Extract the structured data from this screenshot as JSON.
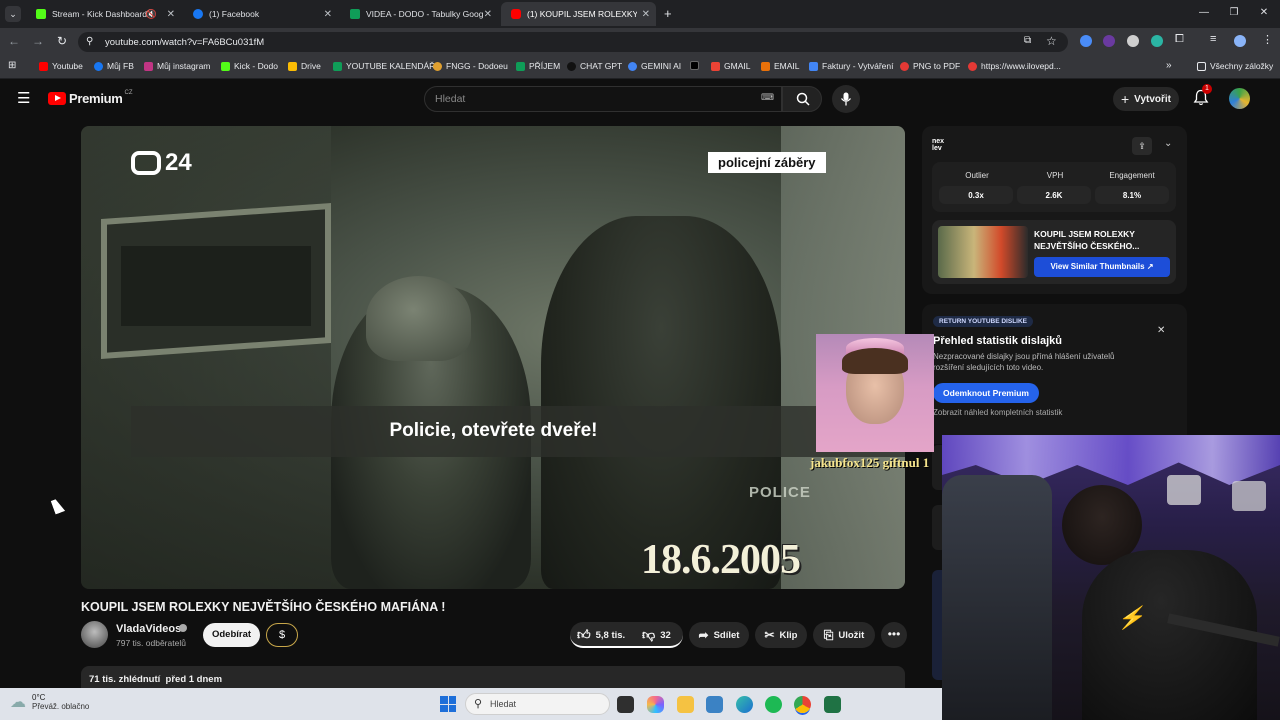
{
  "tabs": [
    {
      "title": "Stream - Kick Dashboard",
      "color": "#53fc18"
    },
    {
      "title": "(1) Facebook",
      "color": "#1877f2"
    },
    {
      "title": "VIDEA - DODO - Tabulky Goog",
      "color": "#0f9d58"
    },
    {
      "title": "(1) KOUPIL JSEM ROLEXKY NEJ",
      "color": "#ff0000"
    }
  ],
  "address": {
    "url": "youtube.com/watch?v=FA6BCu031fM"
  },
  "bookmarks": [
    {
      "label": "Youtube",
      "color": "#ff0000"
    },
    {
      "label": "Můj FB",
      "color": "#1877f2"
    },
    {
      "label": "Můj instagram",
      "color": "#c13584"
    },
    {
      "label": "Kick - Dodo",
      "color": "#53fc18"
    },
    {
      "label": "Drive",
      "color": "#fbbc04"
    },
    {
      "label": "YOUTUBE KALENDÁŘ",
      "color": "#0f9d58"
    },
    {
      "label": "FNGG - Dodoeu",
      "color": "#e0a030"
    },
    {
      "label": "PŘÍJEM",
      "color": "#0f9d58"
    },
    {
      "label": "CHAT GPT",
      "color": "#202124"
    },
    {
      "label": "GEMINI AI",
      "color": "#4285f4"
    },
    {
      "label": "",
      "color": "#000000"
    },
    {
      "label": "GMAIL",
      "color": "#ea4335"
    },
    {
      "label": "EMAIL",
      "color": "#e8710a"
    },
    {
      "label": "Faktury - Vytváření",
      "color": "#4285f4"
    },
    {
      "label": "PNG to PDF",
      "color": "#e53935"
    },
    {
      "label": "https://www.ilovepd...",
      "color": "#e53935"
    }
  ],
  "bookmarks_other": "Všechny záložky",
  "youtube": {
    "logo_text": "Premium",
    "region": "CZ",
    "search_placeholder": "Hledat",
    "create_label": "Vytvořit",
    "notif_count": "1"
  },
  "video": {
    "channel_logo": "24",
    "corner_tag": "policejní záběry",
    "subtitle": "Policie, otevřete dveře!",
    "date_stamp": "18.6.2005",
    "vest_text": "POLICE",
    "title": "KOUPIL JSEM ROLEXKY NEJVĚTŠÍHO ČESKÉHO MAFIÁNA !",
    "channel": "VladaVideos",
    "subscribers": "797 tis. odběratelů",
    "subscribe_label": "Odebírat",
    "likes": "5,8 tis.",
    "dislikes": "32",
    "share_label": "Sdílet",
    "clip_label": "Klip",
    "save_label": "Uložit",
    "views_line": "71 tis. zhlédnutí  před 1 dnem"
  },
  "extension_panel": {
    "logo": "nex lev",
    "stats": [
      {
        "label": "Outlier",
        "value": "0.3x"
      },
      {
        "label": "VPH",
        "value": "2.6K"
      },
      {
        "label": "Engagement",
        "value": "8.1%"
      }
    ],
    "thumb_title": "KOUPIL JSEM ROLEXKY NEJVĚTŠÍHO ČESKÉHO...",
    "similar_btn": "View Similar Thumbnails"
  },
  "dislike_panel": {
    "badge": "RETURN YOUTUBE DISLIKE",
    "title": "Přehled statistik dislajků",
    "desc": "Nezpracované dislajky jsou přímá hlášení uživatelů rozšíření sledujících toto video.",
    "unlock_btn": "Odemknout Premium",
    "preview_link": "Zobrazit náhled kompletních statistik"
  },
  "overlay": {
    "gift_text": "jakubfox125 giftnul 1"
  },
  "taskbar": {
    "weather_temp": "0°C",
    "weather_desc": "Převáž. oblačno",
    "search_placeholder": "Hledat"
  }
}
